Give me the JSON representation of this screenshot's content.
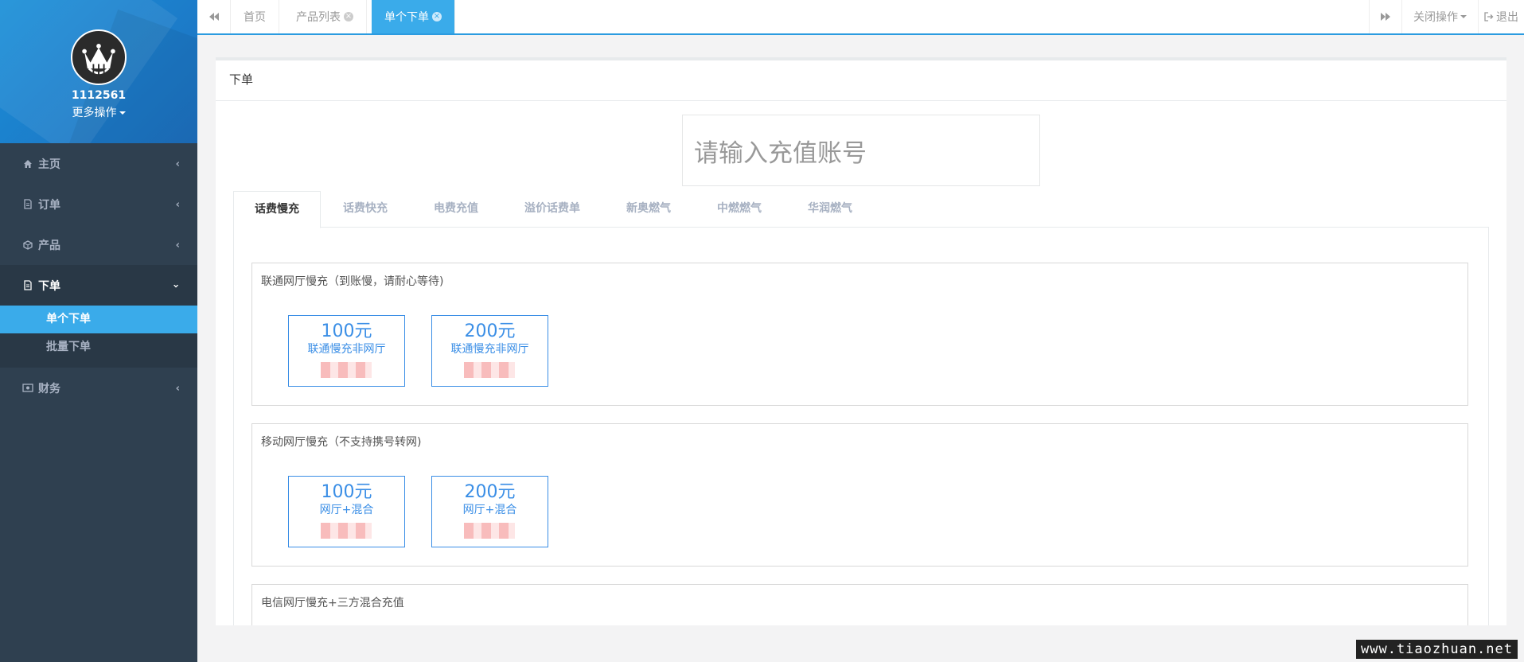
{
  "sidebar": {
    "username": "1112561",
    "more_ops": "更多操作",
    "items": [
      {
        "label": "主页",
        "icon": "home-icon"
      },
      {
        "label": "订单",
        "icon": "file-icon"
      },
      {
        "label": "产品",
        "icon": "cube-icon"
      },
      {
        "label": "下单",
        "icon": "file-text-icon"
      },
      {
        "label": "财务",
        "icon": "money-icon"
      }
    ],
    "sub_items": [
      "单个下单",
      "批量下单"
    ]
  },
  "topbar": {
    "tabs": [
      {
        "label": "首页"
      },
      {
        "label": "产品列表"
      },
      {
        "label": "单个下单"
      }
    ],
    "close_ops": "关闭操作",
    "logout": "退出"
  },
  "panel": {
    "title": "下单",
    "account_placeholder": "请输入充值账号",
    "product_tabs": [
      "话费慢充",
      "话费快充",
      "电费充值",
      "溢价话费单",
      "新奥燃气",
      "中燃燃气",
      "华润燃气"
    ],
    "groups": [
      {
        "title": "联通网厅慢充（到账慢，请耐心等待)",
        "cards": [
          {
            "amount": "100元",
            "desc": "联通慢充非网厅"
          },
          {
            "amount": "200元",
            "desc": "联通慢充非网厅"
          }
        ]
      },
      {
        "title": "移动网厅慢充（不支持携号转网)",
        "cards": [
          {
            "amount": "100元",
            "desc": "网厅+混合"
          },
          {
            "amount": "200元",
            "desc": "网厅+混合"
          }
        ]
      },
      {
        "title": "电信网厅慢充+三方混合充值",
        "cards": []
      }
    ]
  },
  "watermark": "www.tiaozhuan.net",
  "colors": {
    "sidebar_bg": "#2f4050",
    "accent": "#3aabea",
    "card_border": "#3a8ee6"
  }
}
